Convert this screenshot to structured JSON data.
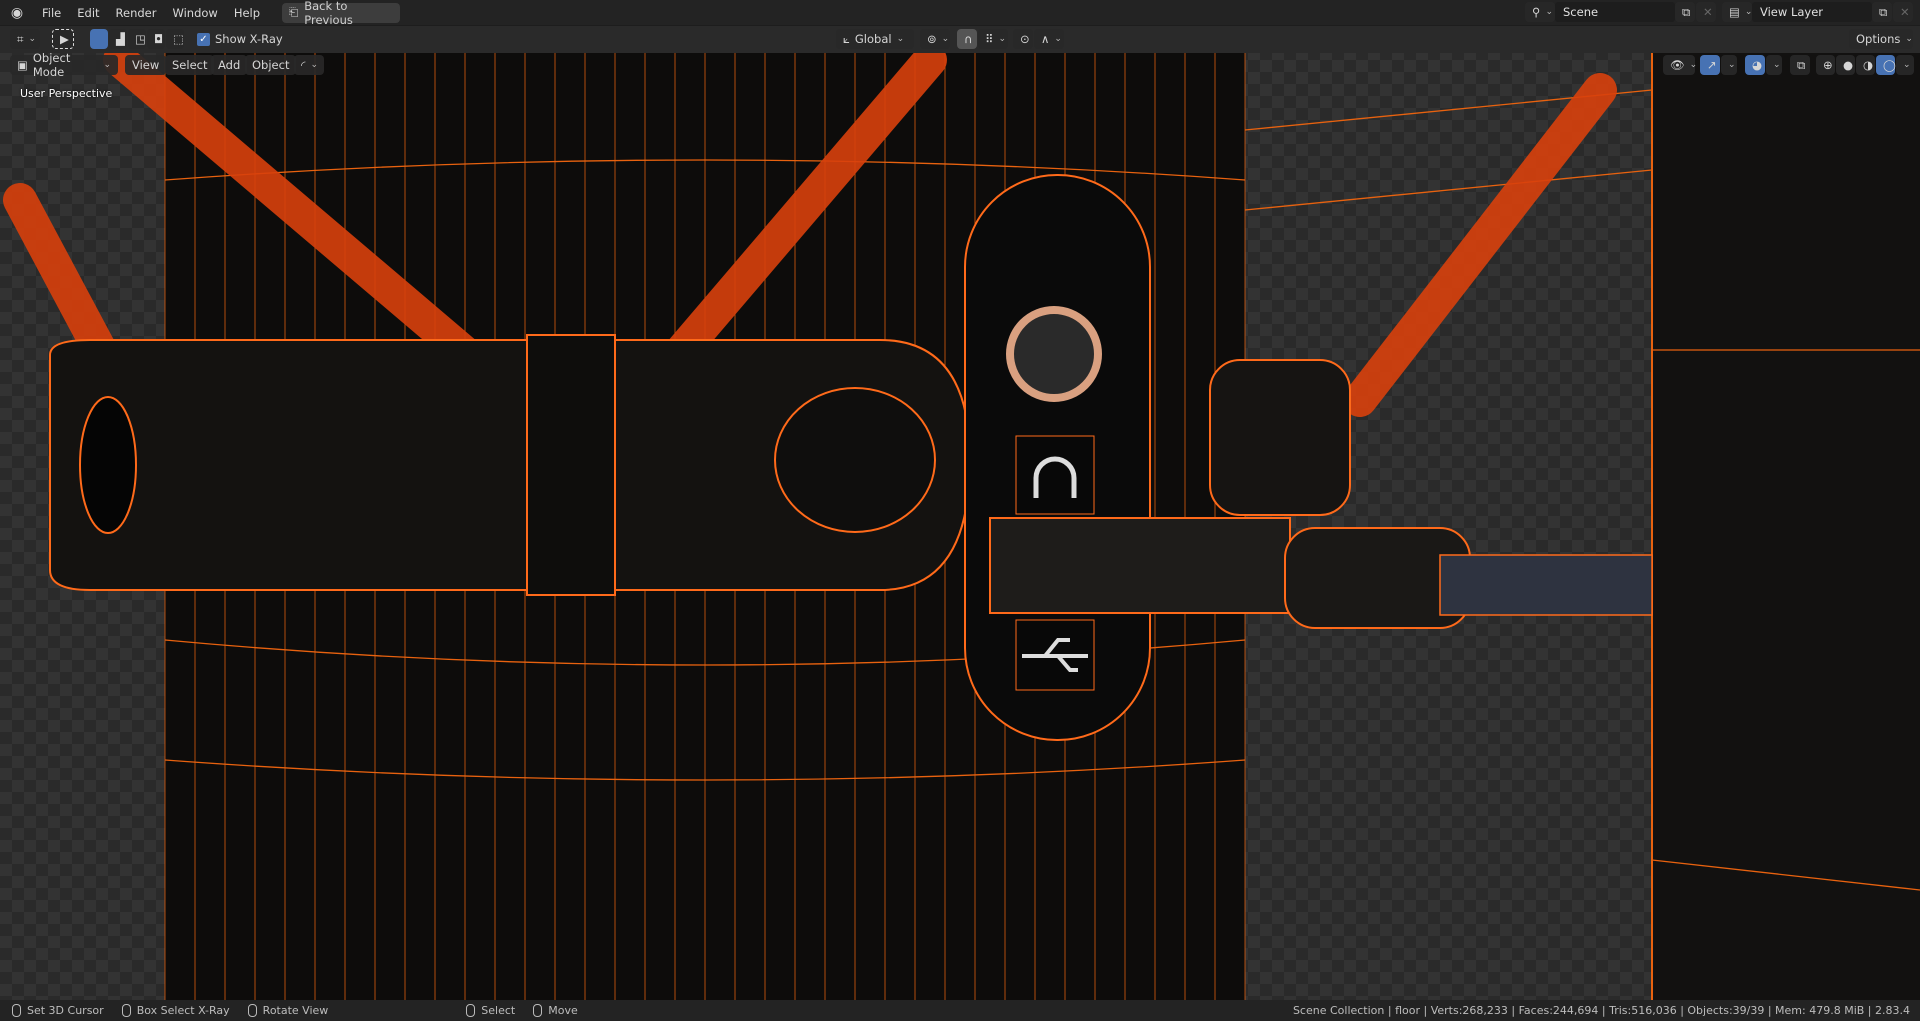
{
  "topbar": {
    "menus": [
      "File",
      "Edit",
      "Render",
      "Window",
      "Help"
    ],
    "back_button": "Back to Previous",
    "scene": "Scene",
    "view_layer": "View Layer"
  },
  "toolheader": {
    "show_xray": "Show X-Ray",
    "xray_checked": true,
    "orientation": "Global",
    "options": "Options"
  },
  "viewport_header": {
    "mode": "Object Mode",
    "menus": [
      "View",
      "Select",
      "Add",
      "Object"
    ]
  },
  "viewport": {
    "label": "User Perspective",
    "wire_color": "#e8620f",
    "selected_color": "#ff6a1a"
  },
  "status": {
    "hints": [
      {
        "icon": "mouse-left-icon",
        "label": "Set 3D Cursor"
      },
      {
        "icon": "mouse-drag-icon",
        "label": "Box Select X-Ray"
      },
      {
        "icon": "mouse-middle-icon",
        "label": "Rotate View"
      },
      {
        "icon": "mouse-left-icon",
        "label": "Select"
      },
      {
        "icon": "mouse-drag-icon",
        "label": "Move"
      }
    ],
    "stats": "Scene Collection | floor | Verts:268,233 | Faces:244,694 | Tris:516,036 | Objects:39/39 | Mem: 479.8 MiB | 2.83.4"
  },
  "colors": {
    "accent": "#4772b3",
    "header": "#232323"
  }
}
